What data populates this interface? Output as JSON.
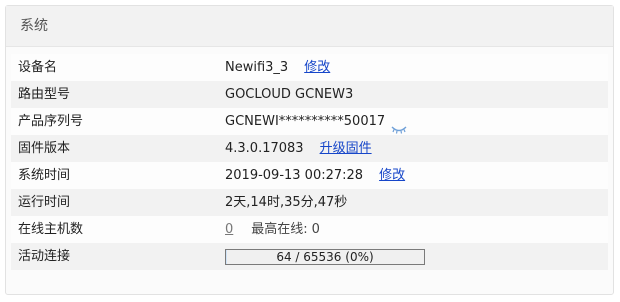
{
  "panel": {
    "title": "系统"
  },
  "rows": {
    "device_name": {
      "label": "设备名",
      "value": "Newifi3_3",
      "action": "修改"
    },
    "router_model": {
      "label": "路由型号",
      "value": "GOCLOUD GCNEW3"
    },
    "serial": {
      "label": "产品序列号",
      "value": "GCNEWI**********50017",
      "icon": "eye-closed-icon"
    },
    "firmware": {
      "label": "固件版本",
      "value": "4.3.0.17083",
      "action": "升级固件"
    },
    "system_time": {
      "label": "系统时间",
      "value": "2019-09-13 00:27:28",
      "action": "修改"
    },
    "uptime": {
      "label": "运行时间",
      "value": "2天,14时,35分,47秒"
    },
    "online_hosts": {
      "label": "在线主机数",
      "value": "0",
      "max_label": "最高在线:",
      "max_value": "0"
    },
    "connections": {
      "label": "活动连接",
      "value": "64 / 65536 (0%)",
      "fraction": 0.001
    }
  },
  "colors": {
    "link": "#1646c9",
    "row_alt": "#f2f2f2"
  }
}
